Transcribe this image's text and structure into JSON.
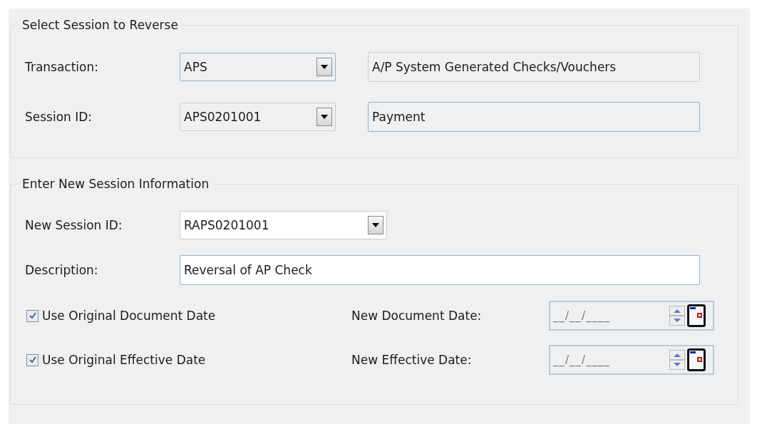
{
  "groups": [
    {
      "title": "Select Session to Reverse",
      "rows": [
        {
          "label": "Transaction:",
          "dropdown": {
            "value": "APS",
            "disabled": true,
            "focused": true
          },
          "description": {
            "value": "A/P System Generated Checks/Vouchers",
            "disabled": true,
            "focused": false
          }
        },
        {
          "label": "Session ID:",
          "dropdown": {
            "value": "APS0201001",
            "disabled": true,
            "focused": false
          },
          "description": {
            "value": "Payment",
            "disabled": true,
            "focused": true
          }
        }
      ]
    },
    {
      "title": "Enter New Session Information",
      "new_session_id": {
        "label": "New Session ID:",
        "value": "RAPS0201001",
        "disabled": false
      },
      "description": {
        "label": "Description:",
        "value": "Reversal of AP Check",
        "disabled": false
      },
      "date_rows": [
        {
          "checkbox": {
            "label": "Use Original Document Date",
            "checked": true
          },
          "date_label": "New Document Date:",
          "date_value": "__/__/____",
          "disabled": true
        },
        {
          "checkbox": {
            "label": "Use Original Effective Date",
            "checked": true
          },
          "date_label": "New Effective Date:",
          "date_value": "__/__/____",
          "disabled": true
        }
      ]
    }
  ]
}
